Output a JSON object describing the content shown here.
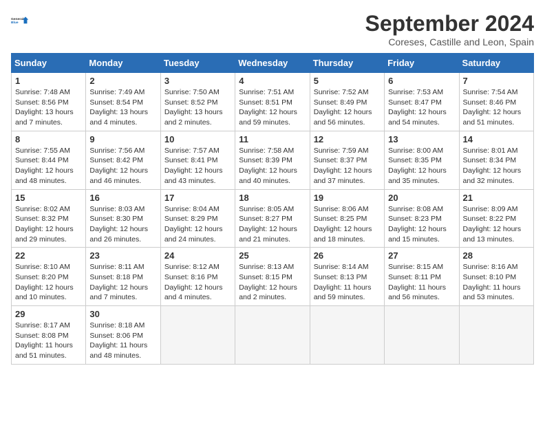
{
  "logo": {
    "line1": "General",
    "line2": "Blue"
  },
  "title": "September 2024",
  "subtitle": "Coreses, Castille and Leon, Spain",
  "days_of_week": [
    "Sunday",
    "Monday",
    "Tuesday",
    "Wednesday",
    "Thursday",
    "Friday",
    "Saturday"
  ],
  "weeks": [
    [
      {
        "day": 1,
        "info": "Sunrise: 7:48 AM\nSunset: 8:56 PM\nDaylight: 13 hours\nand 7 minutes."
      },
      {
        "day": 2,
        "info": "Sunrise: 7:49 AM\nSunset: 8:54 PM\nDaylight: 13 hours\nand 4 minutes."
      },
      {
        "day": 3,
        "info": "Sunrise: 7:50 AM\nSunset: 8:52 PM\nDaylight: 13 hours\nand 2 minutes."
      },
      {
        "day": 4,
        "info": "Sunrise: 7:51 AM\nSunset: 8:51 PM\nDaylight: 12 hours\nand 59 minutes."
      },
      {
        "day": 5,
        "info": "Sunrise: 7:52 AM\nSunset: 8:49 PM\nDaylight: 12 hours\nand 56 minutes."
      },
      {
        "day": 6,
        "info": "Sunrise: 7:53 AM\nSunset: 8:47 PM\nDaylight: 12 hours\nand 54 minutes."
      },
      {
        "day": 7,
        "info": "Sunrise: 7:54 AM\nSunset: 8:46 PM\nDaylight: 12 hours\nand 51 minutes."
      }
    ],
    [
      {
        "day": 8,
        "info": "Sunrise: 7:55 AM\nSunset: 8:44 PM\nDaylight: 12 hours\nand 48 minutes."
      },
      {
        "day": 9,
        "info": "Sunrise: 7:56 AM\nSunset: 8:42 PM\nDaylight: 12 hours\nand 46 minutes."
      },
      {
        "day": 10,
        "info": "Sunrise: 7:57 AM\nSunset: 8:41 PM\nDaylight: 12 hours\nand 43 minutes."
      },
      {
        "day": 11,
        "info": "Sunrise: 7:58 AM\nSunset: 8:39 PM\nDaylight: 12 hours\nand 40 minutes."
      },
      {
        "day": 12,
        "info": "Sunrise: 7:59 AM\nSunset: 8:37 PM\nDaylight: 12 hours\nand 37 minutes."
      },
      {
        "day": 13,
        "info": "Sunrise: 8:00 AM\nSunset: 8:35 PM\nDaylight: 12 hours\nand 35 minutes."
      },
      {
        "day": 14,
        "info": "Sunrise: 8:01 AM\nSunset: 8:34 PM\nDaylight: 12 hours\nand 32 minutes."
      }
    ],
    [
      {
        "day": 15,
        "info": "Sunrise: 8:02 AM\nSunset: 8:32 PM\nDaylight: 12 hours\nand 29 minutes."
      },
      {
        "day": 16,
        "info": "Sunrise: 8:03 AM\nSunset: 8:30 PM\nDaylight: 12 hours\nand 26 minutes."
      },
      {
        "day": 17,
        "info": "Sunrise: 8:04 AM\nSunset: 8:29 PM\nDaylight: 12 hours\nand 24 minutes."
      },
      {
        "day": 18,
        "info": "Sunrise: 8:05 AM\nSunset: 8:27 PM\nDaylight: 12 hours\nand 21 minutes."
      },
      {
        "day": 19,
        "info": "Sunrise: 8:06 AM\nSunset: 8:25 PM\nDaylight: 12 hours\nand 18 minutes."
      },
      {
        "day": 20,
        "info": "Sunrise: 8:08 AM\nSunset: 8:23 PM\nDaylight: 12 hours\nand 15 minutes."
      },
      {
        "day": 21,
        "info": "Sunrise: 8:09 AM\nSunset: 8:22 PM\nDaylight: 12 hours\nand 13 minutes."
      }
    ],
    [
      {
        "day": 22,
        "info": "Sunrise: 8:10 AM\nSunset: 8:20 PM\nDaylight: 12 hours\nand 10 minutes."
      },
      {
        "day": 23,
        "info": "Sunrise: 8:11 AM\nSunset: 8:18 PM\nDaylight: 12 hours\nand 7 minutes."
      },
      {
        "day": 24,
        "info": "Sunrise: 8:12 AM\nSunset: 8:16 PM\nDaylight: 12 hours\nand 4 minutes."
      },
      {
        "day": 25,
        "info": "Sunrise: 8:13 AM\nSunset: 8:15 PM\nDaylight: 12 hours\nand 2 minutes."
      },
      {
        "day": 26,
        "info": "Sunrise: 8:14 AM\nSunset: 8:13 PM\nDaylight: 11 hours\nand 59 minutes."
      },
      {
        "day": 27,
        "info": "Sunrise: 8:15 AM\nSunset: 8:11 PM\nDaylight: 11 hours\nand 56 minutes."
      },
      {
        "day": 28,
        "info": "Sunrise: 8:16 AM\nSunset: 8:10 PM\nDaylight: 11 hours\nand 53 minutes."
      }
    ],
    [
      {
        "day": 29,
        "info": "Sunrise: 8:17 AM\nSunset: 8:08 PM\nDaylight: 11 hours\nand 51 minutes."
      },
      {
        "day": 30,
        "info": "Sunrise: 8:18 AM\nSunset: 8:06 PM\nDaylight: 11 hours\nand 48 minutes."
      },
      null,
      null,
      null,
      null,
      null
    ]
  ]
}
